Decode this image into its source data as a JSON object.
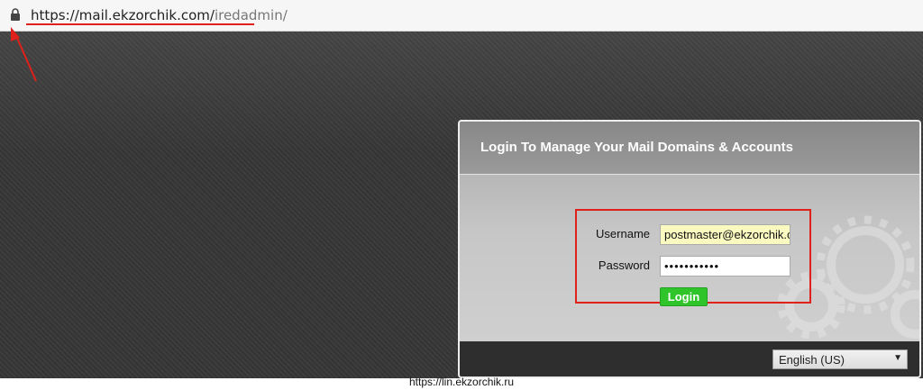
{
  "browser": {
    "url_host": "https://mail.ekzorchik.com/",
    "url_path": "iredadmin/"
  },
  "panel": {
    "title": "Login To Manage Your Mail Domains & Accounts",
    "username_label": "Username",
    "username_value": "postmaster@ekzorchik.c",
    "password_label": "Password",
    "password_value": "•••••••••••",
    "login_label": "Login",
    "language_value": "English (US)"
  },
  "watermark": {
    "text": "https://lin.ekzorchik.ru"
  },
  "icons": [
    "lock-icon",
    "red-arrow-icon",
    "gears-icon",
    "chevron-down-icon"
  ],
  "colors": {
    "accent_red": "#e0201a",
    "login_green": "#2ec42a",
    "page_dark": "#363636"
  }
}
